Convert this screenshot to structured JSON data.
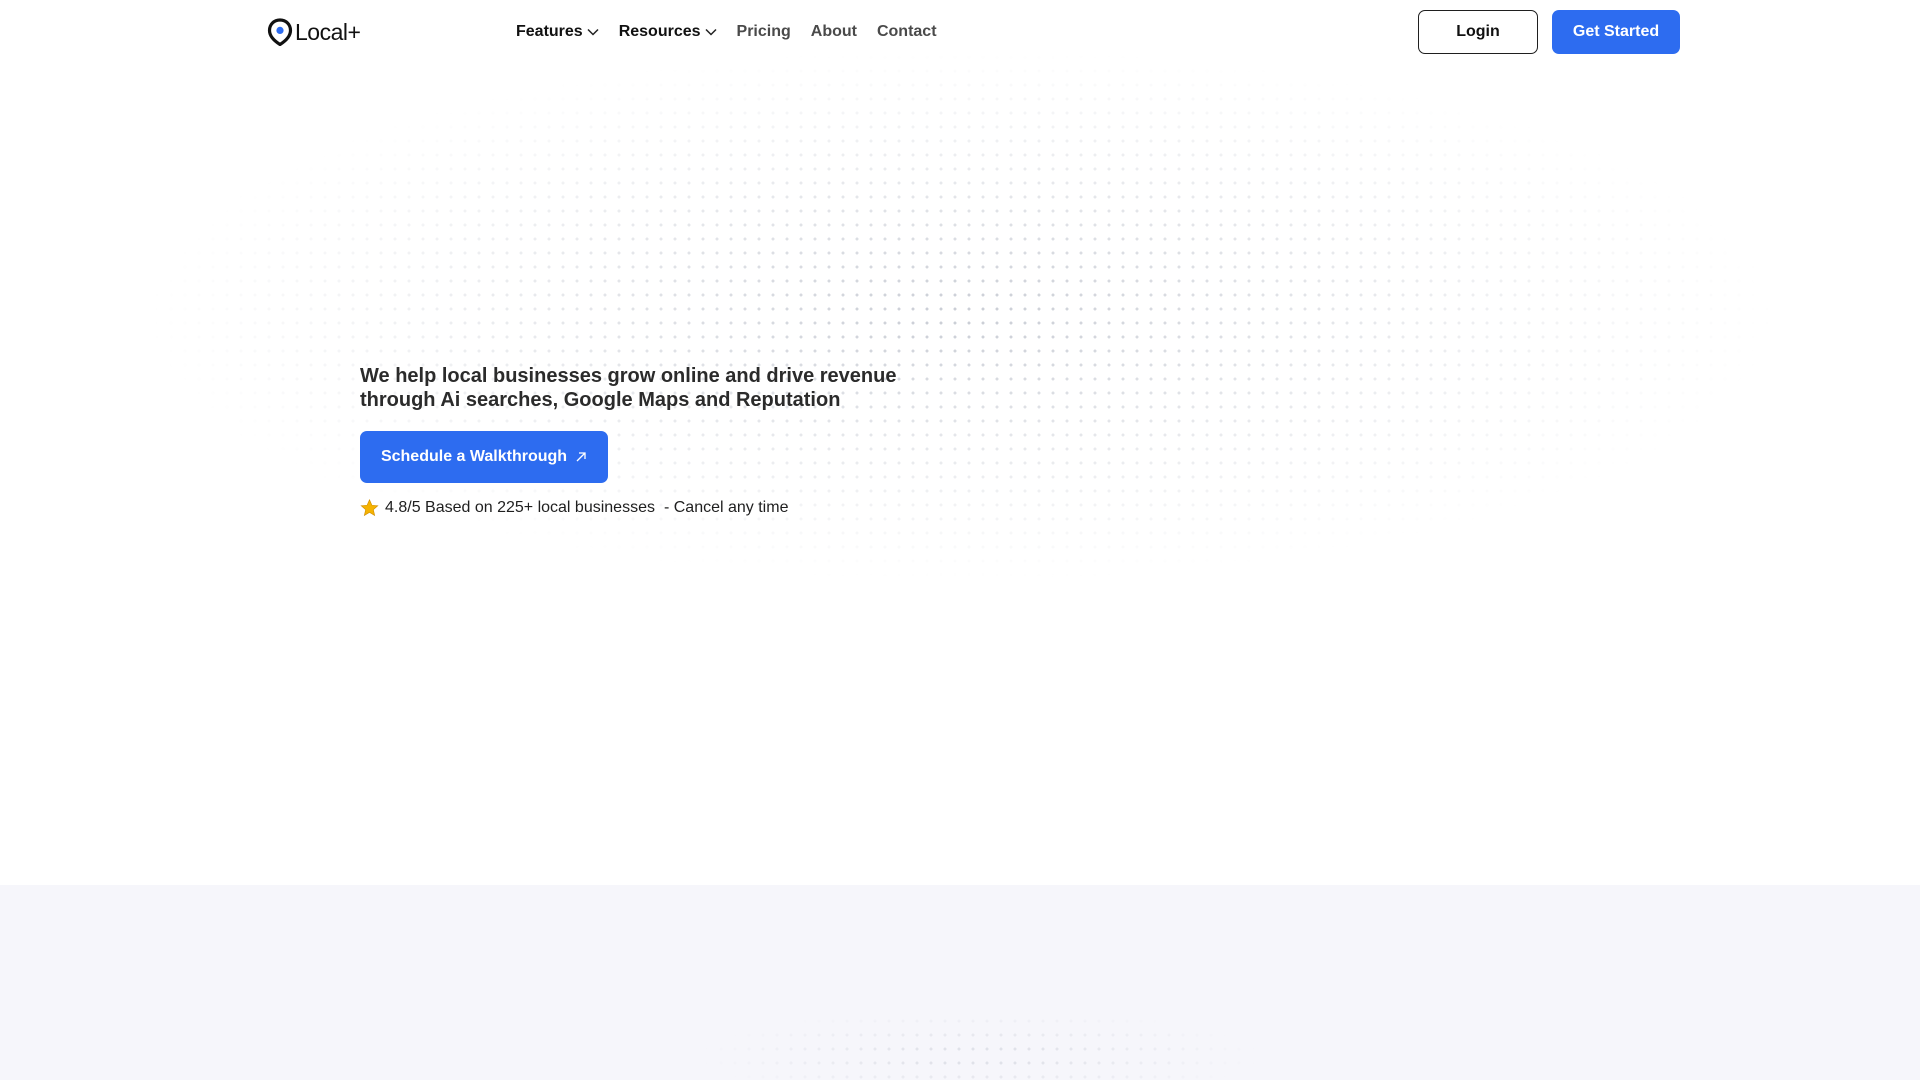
{
  "header": {
    "logo_text": "Local+",
    "nav": [
      {
        "label": "Features",
        "has_dropdown": true
      },
      {
        "label": "Resources",
        "has_dropdown": true
      },
      {
        "label": "Pricing",
        "has_dropdown": false
      },
      {
        "label": "About",
        "has_dropdown": false
      },
      {
        "label": "Contact",
        "has_dropdown": false
      }
    ],
    "login_label": "Login",
    "get_started_label": "Get Started"
  },
  "hero": {
    "heading": "We help local businesses grow online and drive revenue through Ai searches, Google Maps and Reputation",
    "cta_label": "Schedule a Walkthrough",
    "cta_icon": "arrow-up-right-icon",
    "rating_text": "4.8/5 Based on 225+ local businesses",
    "rating_suffix": "- Cancel any time",
    "rating_icon": "star-icon"
  },
  "colors": {
    "accent": "#2d6cf0",
    "text": "#1f1f1f",
    "section_band": "#f6f6fb",
    "star": "#f5b301"
  }
}
